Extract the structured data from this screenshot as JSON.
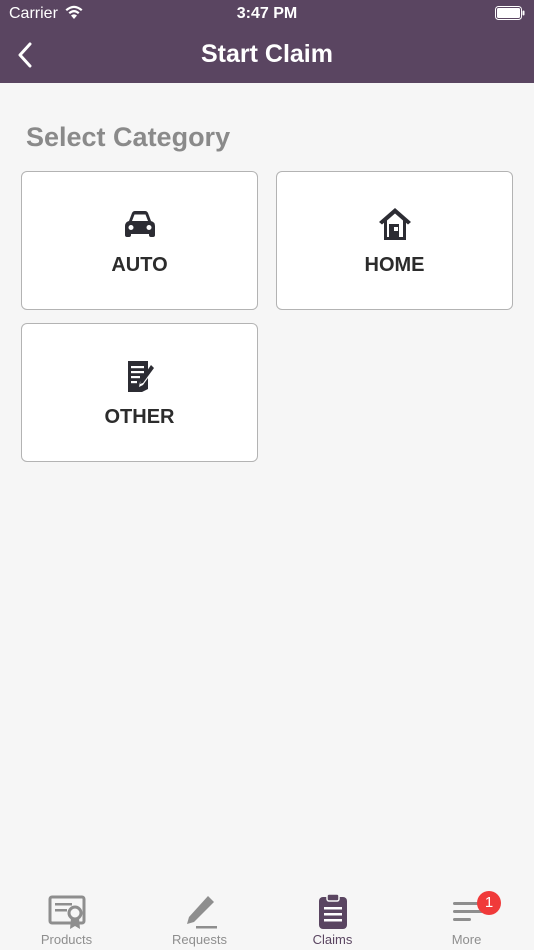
{
  "status_bar": {
    "carrier": "Carrier",
    "time": "3:47 PM"
  },
  "header": {
    "title": "Start Claim"
  },
  "main": {
    "section_title": "Select Category",
    "categories": [
      {
        "label": "AUTO",
        "icon": "car-icon"
      },
      {
        "label": "HOME",
        "icon": "house-icon"
      },
      {
        "label": "OTHER",
        "icon": "document-edit-icon"
      }
    ]
  },
  "tabbar": {
    "tabs": [
      {
        "label": "Products",
        "icon": "certificate-icon",
        "active": false
      },
      {
        "label": "Requests",
        "icon": "pencil-icon",
        "active": false
      },
      {
        "label": "Claims",
        "icon": "clipboard-icon",
        "active": true
      },
      {
        "label": "More",
        "icon": "menu-lines-icon",
        "active": false,
        "badge": "1"
      }
    ]
  },
  "colors": {
    "header_bg": "#5a4561",
    "active_tab": "#5a4561",
    "badge": "#f03a3a",
    "background": "#f6f6f6"
  }
}
